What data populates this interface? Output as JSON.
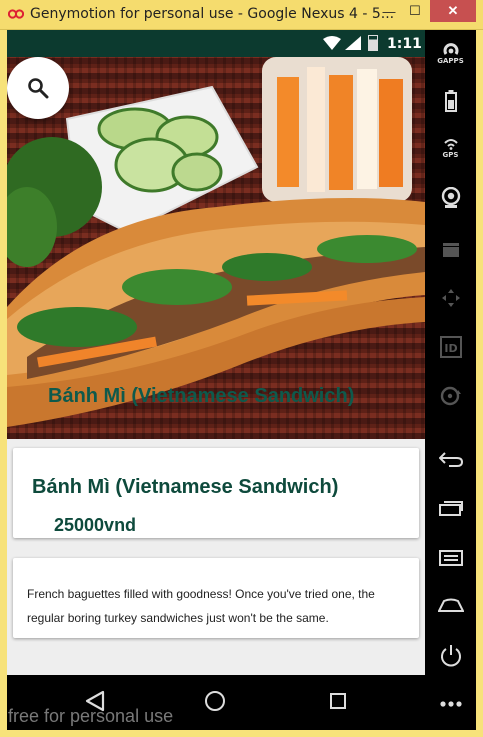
{
  "window": {
    "title": "Genymotion for personal use - Google Nexus 4 - 5...",
    "minimize_glyph": "—",
    "maximize_glyph": "☐",
    "close_glyph": "✕"
  },
  "status_bar": {
    "time": "1:11",
    "icons": [
      "wifi-icon",
      "signal-icon",
      "battery-icon"
    ]
  },
  "hero": {
    "caption": "Bánh Mì (Vietnamese Sandwich)"
  },
  "dish": {
    "title": "Bánh Mì (Vietnamese Sandwich)",
    "price": "25000vnd",
    "description": "French baguettes filled with goodness! Once you've tried one, the regular boring turkey sandwiches just won't be the same."
  },
  "sidebar": {
    "gapps_label": "GAPPS",
    "gps_label": "GPS",
    "id_label": "ID",
    "icons": [
      "gapps-icon",
      "battery-icon",
      "gps-icon",
      "webcam-icon",
      "clapper-icon",
      "dpad-icon",
      "id-icon",
      "disk-icon",
      "back-icon",
      "recent-apps-icon",
      "menu-icon",
      "home-icon",
      "power-icon",
      "more-icon"
    ]
  },
  "colors": {
    "titlebar": "#f5dc6e",
    "status_bar": "#0c3a2f",
    "accent_text": "#0e4a3c",
    "close_button": "#c75050"
  },
  "watermark": "free for personal use"
}
